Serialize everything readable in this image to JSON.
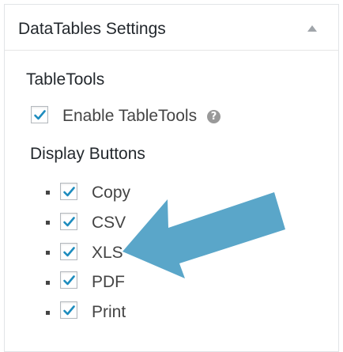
{
  "panel": {
    "title": "DataTables Settings"
  },
  "tabletools": {
    "section_title": "TableTools",
    "enable_label": "Enable TableTools",
    "enable_checked": true,
    "help_glyph": "?"
  },
  "display_buttons": {
    "section_title": "Display Buttons",
    "items": [
      {
        "label": "Copy",
        "checked": true
      },
      {
        "label": "CSV",
        "checked": true
      },
      {
        "label": "XLS",
        "checked": true
      },
      {
        "label": "PDF",
        "checked": true
      },
      {
        "label": "Print",
        "checked": true
      }
    ]
  },
  "annotation": {
    "arrow_color": "#5aa6c9",
    "points_to": "XLS"
  },
  "colors": {
    "checkmark": "#1e8cbe",
    "heading": "#23282d",
    "label": "#444444"
  }
}
